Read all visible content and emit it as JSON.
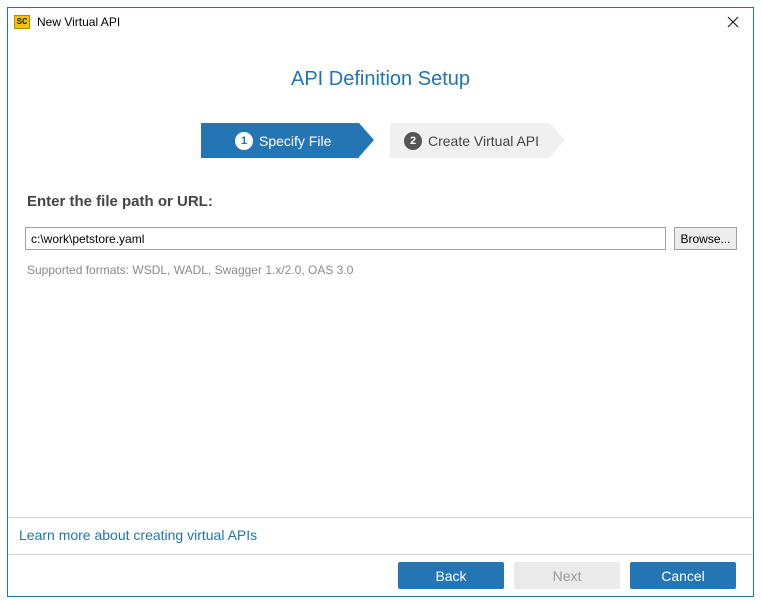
{
  "window": {
    "title": "New Virtual API",
    "app_icon_text": "SC",
    "icons": {
      "app": "app-logo-icon",
      "close": "close-icon"
    }
  },
  "dialog": {
    "heading": "API Definition Setup",
    "steps": [
      {
        "number": "1",
        "label": "Specify File",
        "state": "active"
      },
      {
        "number": "2",
        "label": "Create Virtual API",
        "state": "inactive"
      }
    ],
    "field_label": "Enter the file path or URL:",
    "path_value": "c:\\work\\petstore.yaml",
    "browse_label": "Browse...",
    "hint": "Supported formats: WSDL, WADL, Swagger 1.x/2.0, OAS 3.0",
    "learn_more": "Learn more about creating virtual APIs"
  },
  "footer": {
    "back_label": "Back",
    "next_label": "Next",
    "cancel_label": "Cancel"
  },
  "colors": {
    "accent": "#2475b4",
    "heading": "#1f74b3",
    "disabled_bg": "#eaeaea",
    "hint": "#8a8a8a"
  }
}
